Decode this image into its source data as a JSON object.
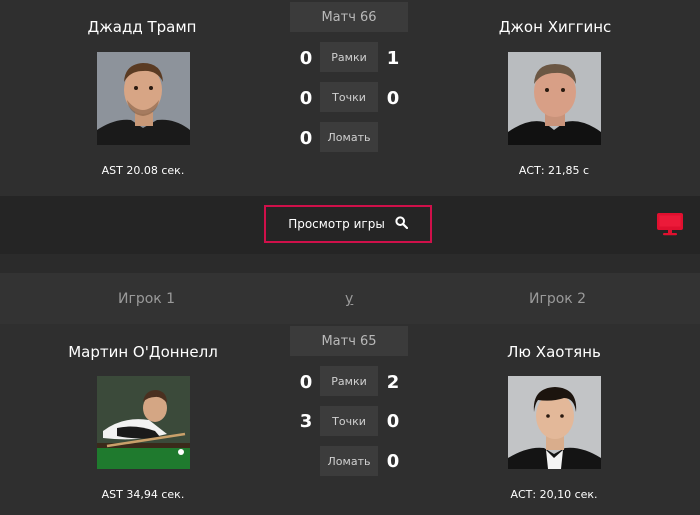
{
  "match1": {
    "label": "Матч 66",
    "left": {
      "name": "Джадд Трамп",
      "ast": "AST 20.08 сек.",
      "frames": "0",
      "points": "0",
      "breaks": "0"
    },
    "right": {
      "name": "Джон Хиггинс",
      "ast": "АСТ: 21,85 с",
      "frames": "1",
      "points": "0"
    },
    "stats": {
      "frames": "Рамки",
      "points": "Точки",
      "breaks": "Ломать"
    }
  },
  "view": {
    "label": "Просмотр игры"
  },
  "players_header": {
    "p1": "Игрок 1",
    "vs": "у",
    "p2": "Игрок 2"
  },
  "match2": {
    "label": "Матч 65",
    "left": {
      "name": "Мартин О'Доннелл",
      "ast": "AST 34,94 сек.",
      "frames": "0",
      "points": "3"
    },
    "right": {
      "name": "Лю Хаотянь",
      "ast": "АСТ: 20,10 сек.",
      "frames": "2",
      "points": "0",
      "breaks": "0"
    },
    "stats": {
      "frames": "Рамки",
      "points": "Точки",
      "breaks": "Ломать"
    }
  },
  "colors": {
    "accent": "#d0104a",
    "tv": "#e0102f"
  },
  "icons": {
    "search": "search-icon",
    "tv": "tv-icon"
  }
}
